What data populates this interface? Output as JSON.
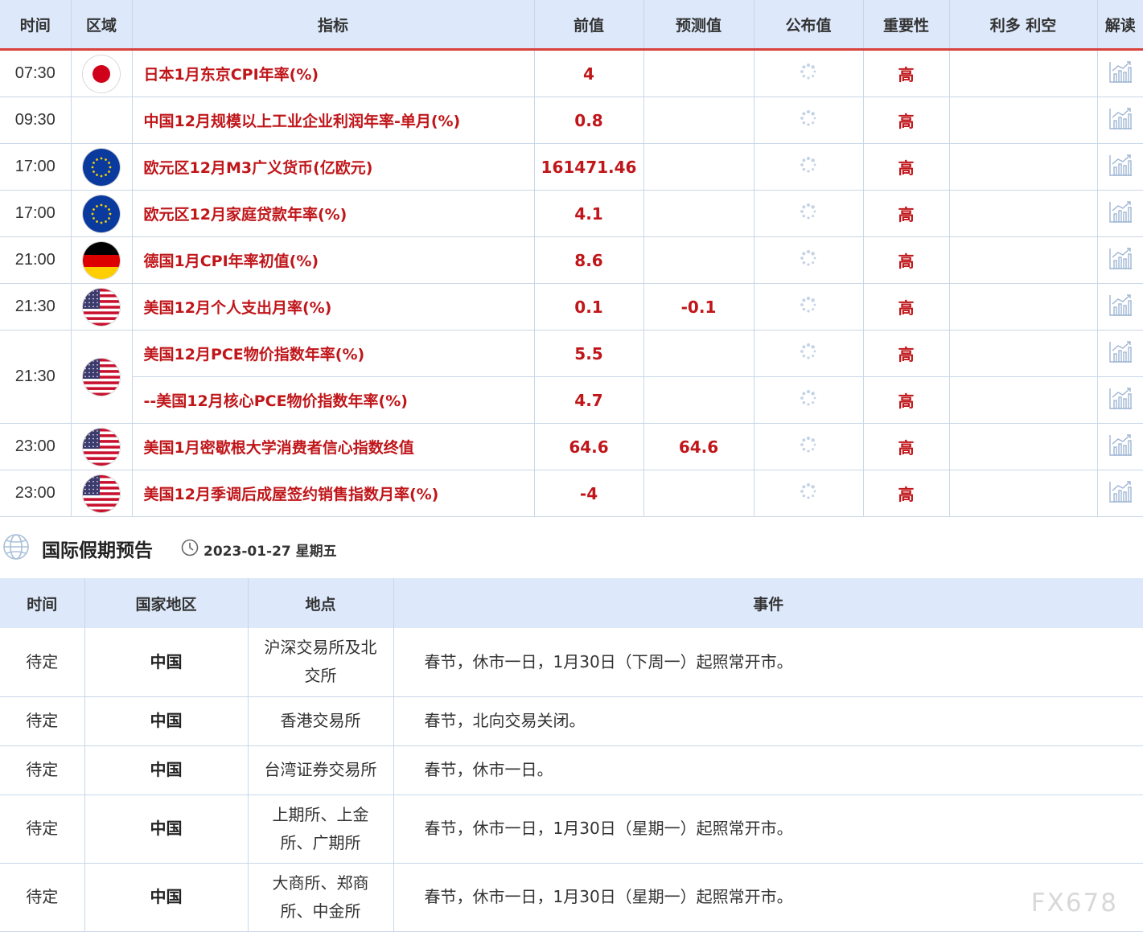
{
  "calendar": {
    "headers": {
      "time": "时间",
      "region": "区域",
      "indicator": "指标",
      "previous": "前值",
      "forecast": "预测值",
      "actual": "公布值",
      "importance": "重要性",
      "impact": "利多 利空",
      "analysis": "解读"
    },
    "rows": [
      {
        "time": "07:30",
        "flag": "japan-flag-icon",
        "indicator": "日本1月东京CPI年率(%)",
        "previous": "4",
        "forecast": "",
        "importance": "高"
      },
      {
        "time": "09:30",
        "flag": "",
        "indicator": "中国12月规模以上工业企业利润年率-单月(%)",
        "previous": "0.8",
        "forecast": "",
        "importance": "高"
      },
      {
        "time": "17:00",
        "flag": "eu-flag-icon",
        "indicator": "欧元区12月M3广义货币(亿欧元)",
        "previous": "161471.46",
        "forecast": "",
        "importance": "高"
      },
      {
        "time": "17:00",
        "flag": "eu-flag-icon",
        "indicator": "欧元区12月家庭贷款年率(%)",
        "previous": "4.1",
        "forecast": "",
        "importance": "高"
      },
      {
        "time": "21:00",
        "flag": "germany-flag-icon",
        "indicator": "德国1月CPI年率初值(%)",
        "previous": "8.6",
        "forecast": "",
        "importance": "高"
      },
      {
        "time": "21:30",
        "flag": "us-flag-icon",
        "indicator": "美国12月个人支出月率(%)",
        "previous": "0.1",
        "forecast": "-0.1",
        "importance": "高"
      },
      {
        "time": "21:30",
        "flag": "us-flag-icon",
        "indicator": "美国12月PCE物价指数年率(%)",
        "previous": "5.5",
        "forecast": "",
        "importance": "高"
      },
      {
        "time": "",
        "flag": "",
        "indicator": "--美国12月核心PCE物价指数年率(%)",
        "previous": "4.7",
        "forecast": "",
        "importance": "高"
      },
      {
        "time": "23:00",
        "flag": "us-flag-icon",
        "indicator": "美国1月密歇根大学消费者信心指数终值",
        "previous": "64.6",
        "forecast": "64.6",
        "importance": "高"
      },
      {
        "time": "23:00",
        "flag": "us-flag-icon",
        "indicator": "美国12月季调后成屋签约销售指数月率(%)",
        "previous": "-4",
        "forecast": "",
        "importance": "高"
      }
    ]
  },
  "holidays": {
    "title": "国际假期预告",
    "date": "2023-01-27 星期五",
    "headers": {
      "time": "时间",
      "country": "国家地区",
      "place": "地点",
      "event": "事件"
    },
    "rows": [
      {
        "time": "待定",
        "country": "中国",
        "place": "沪深交易所及北交所",
        "event": "春节，休市一日，1月30日（下周一）起照常开市。"
      },
      {
        "time": "待定",
        "country": "中国",
        "place": "香港交易所",
        "event": "春节，北向交易关闭。"
      },
      {
        "time": "待定",
        "country": "中国",
        "place": "台湾证券交易所",
        "event": "春节，休市一日。"
      },
      {
        "time": "待定",
        "country": "中国",
        "place": "上期所、上金所、广期所",
        "event": "春节，休市一日，1月30日（星期一）起照常开市。"
      },
      {
        "time": "待定",
        "country": "中国",
        "place": "大商所、郑商所、中金所",
        "event": "春节，休市一日，1月30日（星期一）起照常开市。"
      }
    ]
  },
  "watermark": "FX678",
  "colors": {
    "accent_red": "#c0161a",
    "header_bg": "#dde9fa",
    "header_rule": "#d9423c"
  }
}
